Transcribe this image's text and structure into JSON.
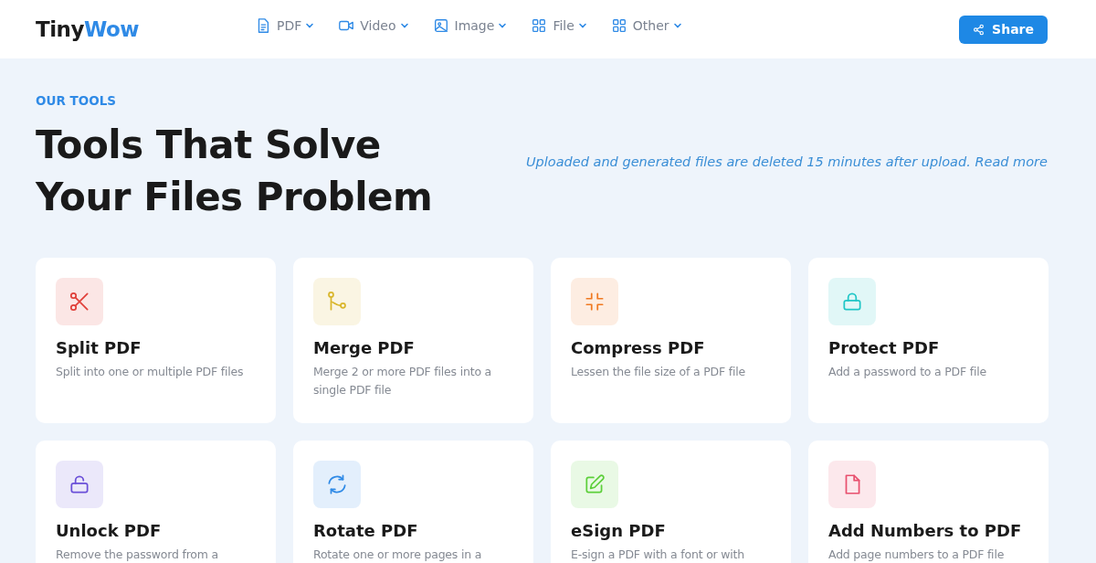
{
  "header": {
    "logo": {
      "part_1": "Tiny",
      "part_2": "Wow"
    },
    "nav": [
      {
        "label": "PDF",
        "kind": "file"
      },
      {
        "label": "Video",
        "kind": "video"
      },
      {
        "label": "Image",
        "kind": "image"
      },
      {
        "label": "File",
        "kind": "grid"
      },
      {
        "label": "Other",
        "kind": "grid"
      }
    ],
    "share_button": "Share"
  },
  "hero": {
    "eyebrow": "OUR TOOLS",
    "title_line_1": "Tools That Solve",
    "title_line_2": "Your Files Problem",
    "note": "Uploaded and generated files are deleted 15 minutes after upload.",
    "note_link": "Read more"
  },
  "tools": [
    {
      "title": "Split PDF",
      "description": "Split into one or multiple PDF files",
      "kind": "scissors",
      "color": "#e0403a"
    },
    {
      "title": "Merge PDF",
      "description": "Merge 2 or more PDF files into a single PDF file",
      "kind": "merge",
      "color": "#d9b62c"
    },
    {
      "title": "Compress PDF",
      "description": "Lessen the file size of a PDF file",
      "kind": "compress",
      "color": "#f07a22"
    },
    {
      "title": "Protect PDF",
      "description": "Add a password to a PDF file",
      "kind": "lock",
      "color": "#1fc6c6"
    },
    {
      "title": "Unlock PDF",
      "description": "Remove the password from a",
      "kind": "unlock",
      "color": "#6a4fd8"
    },
    {
      "title": "Rotate PDF",
      "description": "Rotate one or more pages in a",
      "kind": "rotate",
      "color": "#2f8ae6"
    },
    {
      "title": "eSign PDF",
      "description": "E-sign a PDF with a font or with",
      "kind": "edit",
      "color": "#5ccf3a"
    },
    {
      "title": "Add Numbers to PDF",
      "description": "Add page numbers to a PDF file",
      "kind": "file",
      "color": "#e8506e"
    }
  ]
}
